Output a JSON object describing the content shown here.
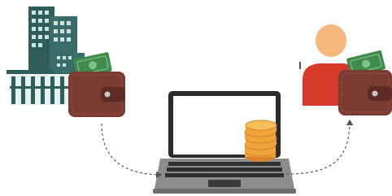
{
  "diagram": {
    "nodes": [
      {
        "id": "company",
        "icon": "office-building-icon"
      },
      {
        "id": "company-wallet",
        "icon": "wallet-with-cash-icon"
      },
      {
        "id": "laptop",
        "icon": "laptop-icon"
      },
      {
        "id": "coins",
        "icon": "coin-stack-icon"
      },
      {
        "id": "person",
        "icon": "person-icon"
      },
      {
        "id": "person-wallet",
        "icon": "wallet-with-cash-icon"
      }
    ],
    "edges": [
      {
        "from": "company-wallet",
        "to": "laptop",
        "style": "dashed-arrow"
      },
      {
        "from": "laptop",
        "to": "person-wallet",
        "style": "dashed-arrow"
      }
    ]
  },
  "colors": {
    "building": "#2f5d5a",
    "building_windows": "#cfe3e1",
    "wallet": "#7a3b33",
    "wallet_dark": "#5e2a24",
    "cash": "#3f8b4a",
    "laptop_frame": "#2b2b2b",
    "laptop_body": "#8c8c8c",
    "coin": "#f2a33a",
    "coin_edge": "#d9832a",
    "person_head": "#f6b77d",
    "person_shirt": "#d63b2a",
    "arrow": "#555555"
  }
}
